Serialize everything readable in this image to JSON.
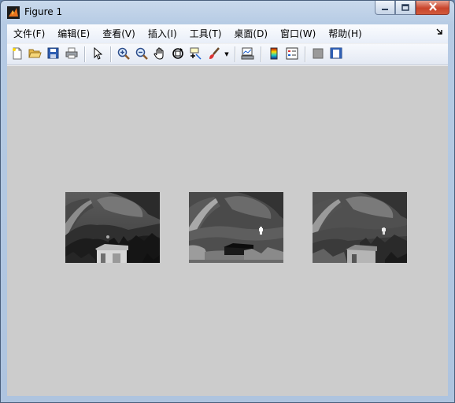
{
  "window": {
    "title": "Figure 1",
    "icons": {
      "app": "matlab-logo-icon",
      "minimize": "minimize-icon",
      "maximize": "maximize-icon",
      "close": "close-icon"
    }
  },
  "menubar": {
    "items": [
      "文件(F)",
      "编辑(E)",
      "查看(V)",
      "插入(I)",
      "工具(T)",
      "桌面(D)",
      "窗口(W)",
      "帮助(H)"
    ],
    "corner_icon": "dock-arrow-icon"
  },
  "toolbar": {
    "buttons": [
      "new-figure-icon",
      "open-file-icon",
      "save-icon",
      "print-icon",
      "pointer-icon",
      "zoom-in-icon",
      "zoom-out-icon",
      "pan-hand-icon",
      "rotate-3d-icon",
      "data-cursor-icon",
      "brush-icon",
      "link-plot-icon",
      "colorbar-icon",
      "legend-icon",
      "hide-plot-tools-icon",
      "show-plot-tools-icon"
    ]
  },
  "figure": {
    "background": "#cccccc",
    "images": [
      {
        "name": "image-original",
        "tone": "dark"
      },
      {
        "name": "image-enhanced",
        "tone": "light"
      },
      {
        "name": "image-fused",
        "tone": "mid"
      }
    ]
  },
  "colors": {
    "close_red": "#c9442b",
    "title_blue": "#b6cbe4"
  }
}
